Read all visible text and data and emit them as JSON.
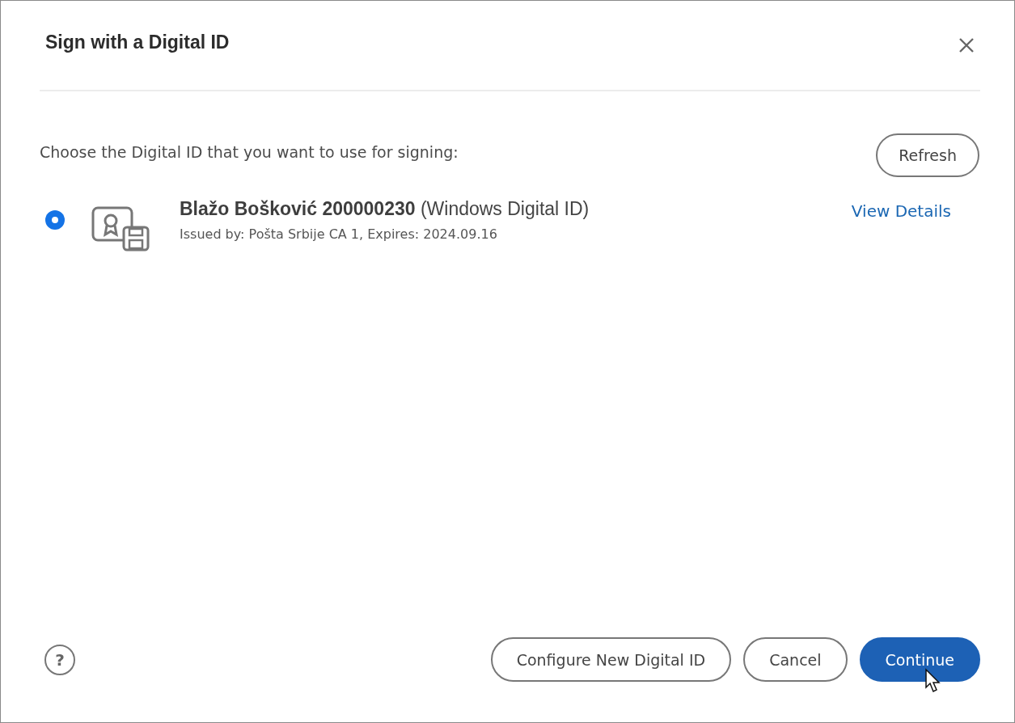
{
  "dialog": {
    "title": "Sign with a Digital ID"
  },
  "prompt": "Choose the Digital ID that you want to use for signing:",
  "refresh_button": "Refresh",
  "ids": [
    {
      "name": "**Blažo Bošković 200000230** (Windows Digital ID)",
      "issuer": "Issued by: Pošta Srbije CA 1, Expires: 2024.09.16",
      "selected": true,
      "link": "View Details"
    }
  ],
  "help": "?",
  "buttons": [
    {
      "label": "Configure New Digital ID",
      "kind": "secondary"
    },
    {
      "label": "Cancel",
      "kind": "secondary"
    },
    {
      "label": "Continue",
      "kind": "primary"
    }
  ]
}
